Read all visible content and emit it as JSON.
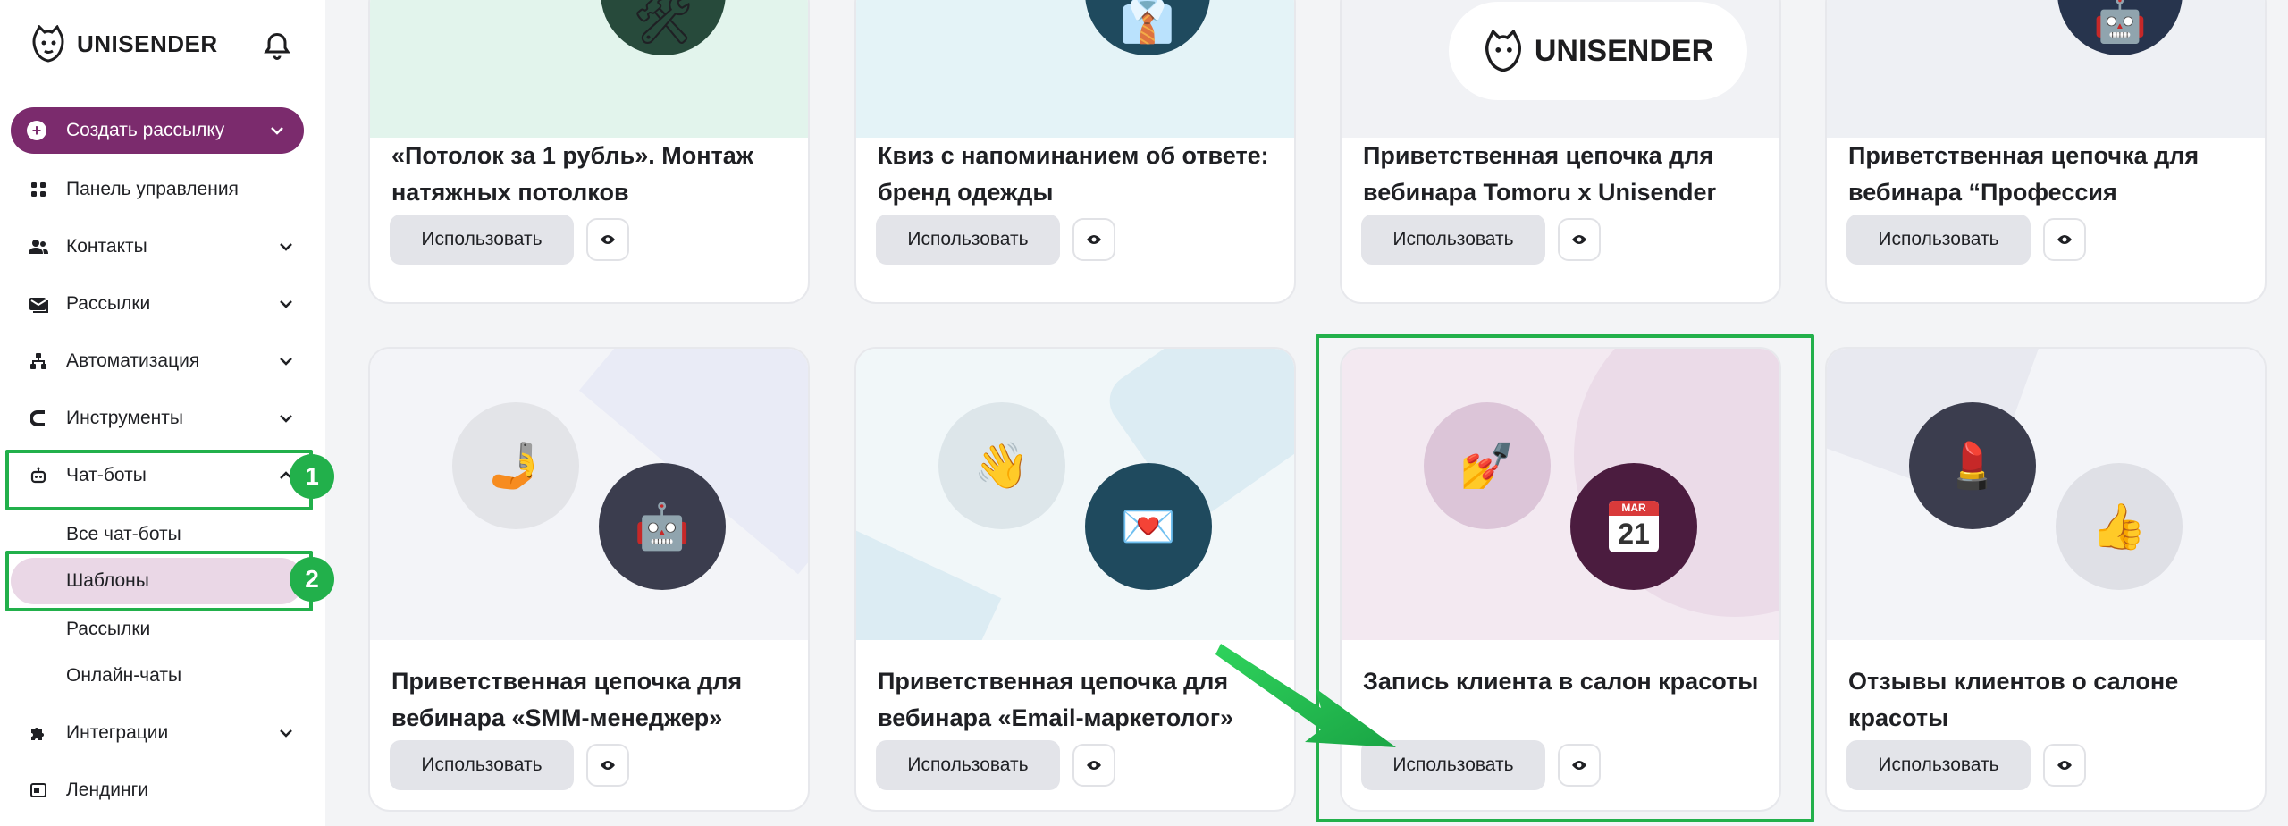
{
  "brand": {
    "name": "UNISENDER"
  },
  "sidebar": {
    "create_label": "Создать рассылку",
    "items": [
      {
        "label": "Панель управления"
      },
      {
        "label": "Контакты"
      },
      {
        "label": "Рассылки"
      },
      {
        "label": "Автоматизация"
      },
      {
        "label": "Инструменты"
      },
      {
        "label": "Чат-боты"
      },
      {
        "label": "Интеграции"
      },
      {
        "label": "Лендинги"
      }
    ],
    "chatbot_subitems": [
      {
        "label": "Все чат-боты"
      },
      {
        "label": "Шаблоны"
      },
      {
        "label": "Рассылки"
      },
      {
        "label": "Онлайн-чаты"
      }
    ]
  },
  "annotations": {
    "badge1": "1",
    "badge2": "2"
  },
  "cards": [
    {
      "title": "«Потолок за 1 рубль». Монтаж натяжных потолков",
      "button": "Использовать"
    },
    {
      "title": "Квиз с напоминанием об ответе: бренд одежды",
      "button": "Использовать"
    },
    {
      "title": "Приветственная цепочка для вебинара Tomoru x Unisender",
      "button": "Использовать",
      "art_logo": "UNISENDER"
    },
    {
      "title": "Приветственная цепочка для вебинара “Профессия",
      "button": "Использовать"
    },
    {
      "title": "Приветственная цепочка для вебинара «SMM-менеджер»",
      "button": "Использовать"
    },
    {
      "title": "Приветственная цепочка для вебинара «Email-маркетолог»",
      "button": "Использовать"
    },
    {
      "title": "Запись клиента в салон красоты",
      "button": "Использовать",
      "calendar_month": "MAR",
      "calendar_day": "21"
    },
    {
      "title": "Отзывы клиентов о салоне красоты",
      "button": "Использовать"
    }
  ],
  "colors": {
    "accent": "#7b2b6d",
    "highlight": "#22b04b",
    "selected_bg": "#ead7e6"
  }
}
